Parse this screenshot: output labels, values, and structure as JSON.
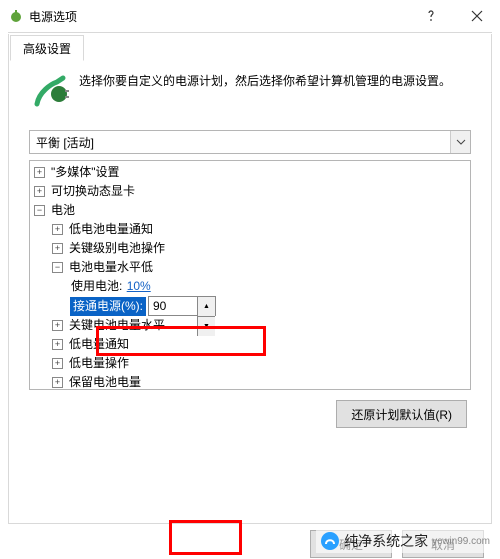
{
  "window": {
    "title": "电源选项"
  },
  "tabs": {
    "advanced": "高级设置"
  },
  "description": "选择你要自定义的电源计划，然后选择你希望计算机管理的电源设置。",
  "plan_select": {
    "current": "平衡 [活动]"
  },
  "tree": {
    "multimedia": "\"多媒体\"设置",
    "switchable_gpu": "可切换动态显卡",
    "battery": "电池",
    "low_notify": "低电池电量通知",
    "critical_action": "关键级别电池操作",
    "low_level": "电池电量水平低",
    "on_battery_label": "使用电池:",
    "on_battery_value": "10%",
    "plugged_label": "接通电源(%):",
    "plugged_value": "90",
    "critical_level": "关键电池电量水平",
    "low_notify2": "低电量通知",
    "low_action": "低电量操作",
    "reserve": "保留电池电量"
  },
  "buttons": {
    "restore": "还原计划默认值(R)",
    "ok": "确定",
    "cancel": "取消"
  },
  "watermark": {
    "brand": "纯净系统之家",
    "url": "ycwin99.com"
  }
}
